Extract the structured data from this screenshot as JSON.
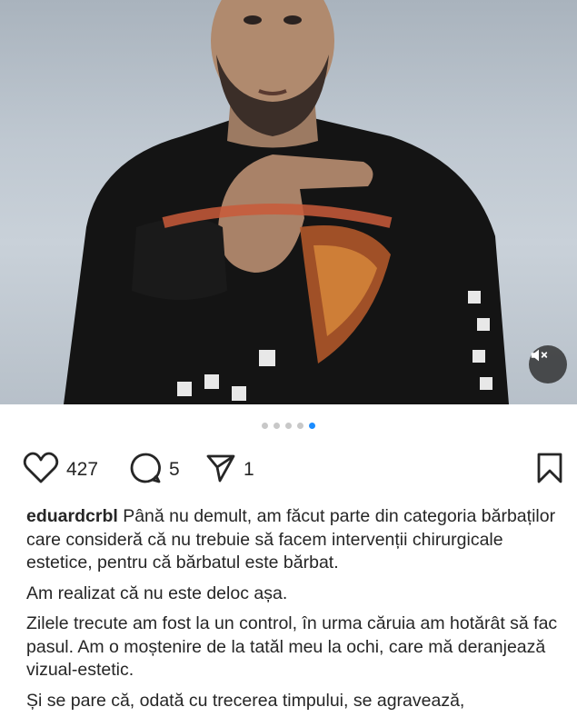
{
  "post": {
    "username": "eduardcrbl",
    "paragraphs": [
      "Până nu demult, am făcut parte din categoria bărbaților care consideră că nu trebuie să facem intervenții chirurgicale estetice, pentru că bărbatul este bărbat.",
      "Am realizat că nu este deloc așa.",
      "Zilele trecute am fost la un control, în urma căruia am hotărât să fac pasul. Am o moștenire de la tatăl meu la ochi, care mă deranjează vizual-estetic.",
      "Și se pare că, odată cu trecerea timpului, se agravează,"
    ]
  },
  "actions": {
    "likes": "427",
    "comments": "5",
    "shares": "1"
  },
  "carousel": {
    "total": 5,
    "active_index": 4
  },
  "icons": {
    "like": "heart-icon",
    "comment": "comment-icon",
    "share": "send-icon",
    "save": "bookmark-icon",
    "mute": "speaker-muted-icon"
  },
  "colors": {
    "active_dot": "#1a8cff",
    "inactive_dot": "#c8c8c8",
    "text": "#262626"
  }
}
